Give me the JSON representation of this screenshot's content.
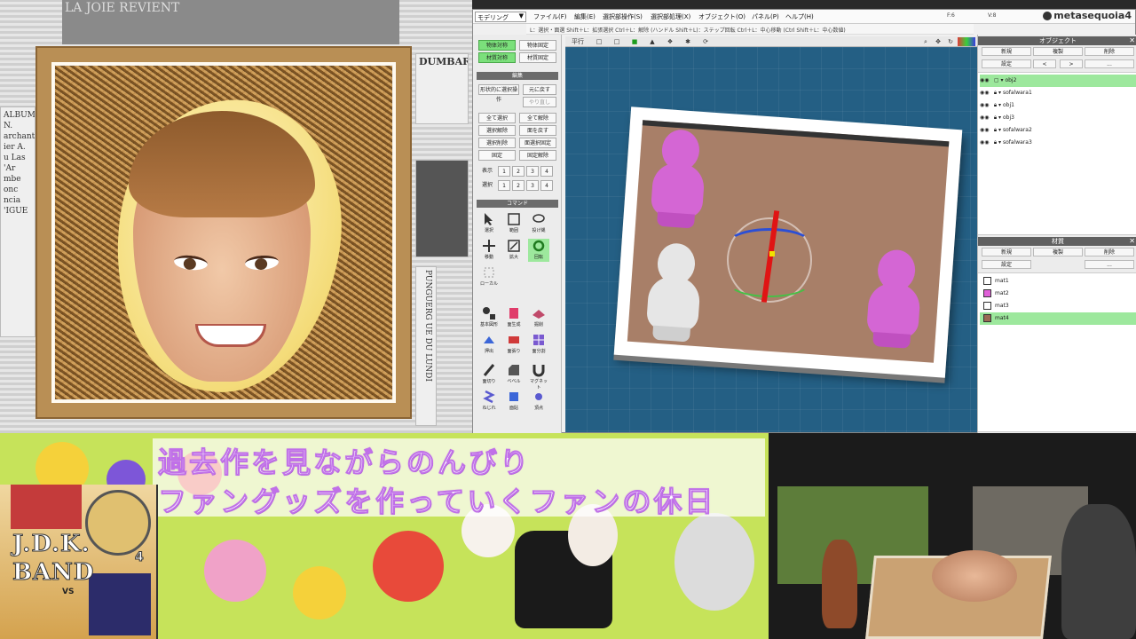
{
  "stream_caption": {
    "line1": "過去作を見ながらのんびり",
    "line2": "ファングッズを作っていくファンの休日"
  },
  "album_cover": {
    "line1": "J.D.K.",
    "line2": "BAND",
    "vs": "VS",
    "number": "4"
  },
  "newspaper": {
    "col1": "ALBUMS N. archant ier A. u Las 'Ar mbe onc ncia 'IGUE",
    "col2": "DUMBARTON",
    "col3": "PUNGUERG UE DU LUNDI",
    "col4": "LA JOIE REVIENT"
  },
  "app": {
    "name": "metasequoia4",
    "mode_select": "モデリング",
    "menu": [
      "ファイル(F)",
      "編集(E)",
      "選択部操作(S)",
      "選択部処理(X)",
      "オブジェクト(O)",
      "パネル(P)",
      "ヘルプ(H)"
    ],
    "stats": [
      "F:6",
      "V:8"
    ],
    "hint": "L：選択・面選 Shift＋L：拡張選択 Ctrl＋L：解除 (ハンドル Shift＋L)：ステップ回転 Ctrl＋L：中心移動 (Ctrl Shift＋L：中心数値)",
    "left_panel": {
      "top_buttons": [
        "物体対称",
        "物体固定",
        "材質対称",
        "材質固定"
      ],
      "edit_header": "編集",
      "edit_buttons": [
        "形状的に選択操作",
        "元に戻す",
        "やり直し",
        "全て選択",
        "全て解除",
        "選択解除",
        "面を戻す",
        "選択削除",
        "面選択固定",
        "固定",
        "固定解除"
      ],
      "grid_labels": [
        "表示",
        "1",
        "2",
        "3",
        "4",
        "選択",
        "1",
        "2",
        "3",
        "4"
      ],
      "command_header": "コマンド",
      "commands": [
        "選択",
        "範囲",
        "投げ縄",
        "移動",
        "拡大",
        "回転",
        "ローカル",
        "基本図形",
        "面生成",
        "掘削",
        "押出",
        "面張り",
        "面分割",
        "面切り",
        "ベベル",
        "マグネット",
        "ねじれ",
        "面貼",
        "頂点"
      ]
    },
    "viewport_tools": [
      "平行",
      "□",
      "□",
      "■",
      "▲",
      "❖",
      "✱",
      "⟳"
    ],
    "right_panel": {
      "object_header": "オブジェクト",
      "object_buttons": [
        "新規",
        "複製",
        "削除",
        "設定",
        "<",
        ">",
        "..."
      ],
      "objects": [
        {
          "name": "obj2",
          "selected": true
        },
        {
          "name": "sofalwara1",
          "selected": false
        },
        {
          "name": "obj1",
          "selected": false
        },
        {
          "name": "obj3",
          "selected": false
        },
        {
          "name": "sofalwara2",
          "selected": false
        },
        {
          "name": "sofalwara3",
          "selected": false
        }
      ],
      "material_header": "材質",
      "material_buttons": [
        "新規",
        "複製",
        "削除",
        "設定",
        "..."
      ],
      "materials": [
        {
          "name": "mat1",
          "color": "#ffffff",
          "selected": false
        },
        {
          "name": "mat2",
          "color": "#e060d8",
          "selected": false
        },
        {
          "name": "mat3",
          "color": "#ffffff",
          "selected": false
        },
        {
          "name": "mat4",
          "color": "#9a6a54",
          "selected": true
        }
      ]
    }
  },
  "colors": {
    "viewport_bg": "#245f84",
    "accent_green": "#7be07b",
    "figure_pink": "#d466d4",
    "figure_white": "#e6e6e6",
    "gizmo_red": "#e01414",
    "caption_outline": "#c070e8"
  }
}
